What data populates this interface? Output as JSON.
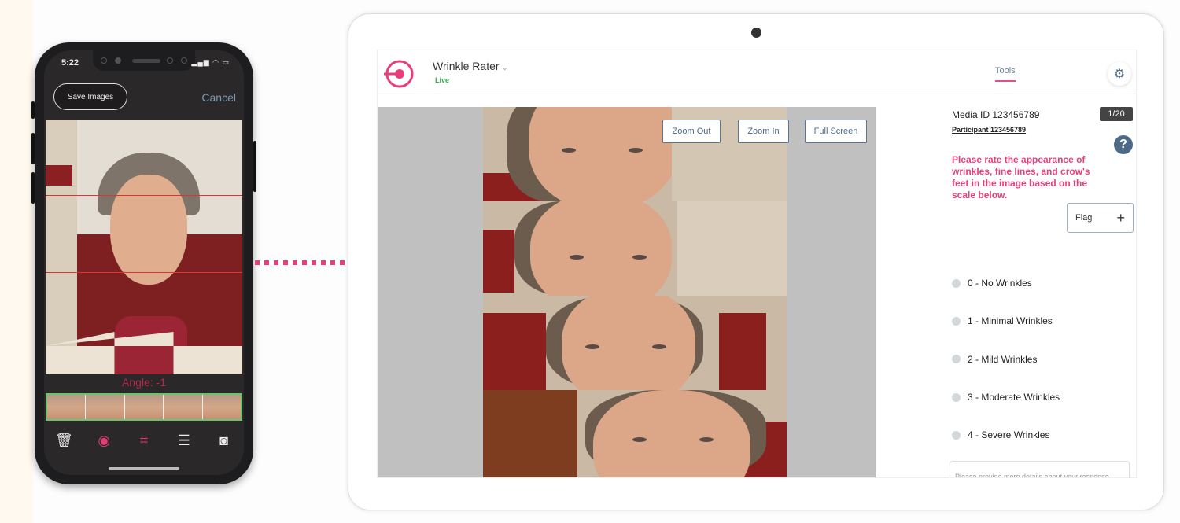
{
  "phone": {
    "status_time": "5:22",
    "status_icons": "signal wifi battery",
    "save_images_label": "Save Images",
    "cancel_label": "Cancel",
    "angle_label": "Angle: -1",
    "filmstrip_count": 5,
    "toolbar": [
      {
        "icon": "trash-icon",
        "glyph": "🗑",
        "active": false
      },
      {
        "icon": "eye-icon",
        "glyph": "◉",
        "active": true
      },
      {
        "icon": "crop-icon",
        "glyph": "⌗",
        "active": true
      },
      {
        "icon": "sliders-icon",
        "glyph": "☰",
        "active": false
      },
      {
        "icon": "camera-switch-icon",
        "glyph": "◙",
        "active": false
      }
    ]
  },
  "app": {
    "title": "Wrinkle Rater",
    "title_chevron": "⌄",
    "status": "Live",
    "tools_tab": "Tools",
    "settings_icon": "⚙",
    "brand_color": "#e73f7c"
  },
  "viewer": {
    "zoom_out_label": "Zoom Out",
    "zoom_in_label": "Zoom In",
    "full_screen_label": "Full Screen"
  },
  "panel": {
    "media_id": "Media ID 123456789",
    "counter": "1/20",
    "participant": "Participant 123456789",
    "help_icon": "?",
    "instruction": "Please rate the appearance of wrinkles, fine lines, and crow's feet in the image based on the scale below.",
    "flag_label": "Flag",
    "flag_icon": "+",
    "options": [
      {
        "label": "0 - No Wrinkles"
      },
      {
        "label": "1 - Minimal Wrinkles"
      },
      {
        "label": "2 - Mild Wrinkles"
      },
      {
        "label": "3 - Moderate Wrinkles"
      },
      {
        "label": "4 - Severe Wrinkles"
      }
    ],
    "details_placeholder": "Please provide more details about your response"
  }
}
